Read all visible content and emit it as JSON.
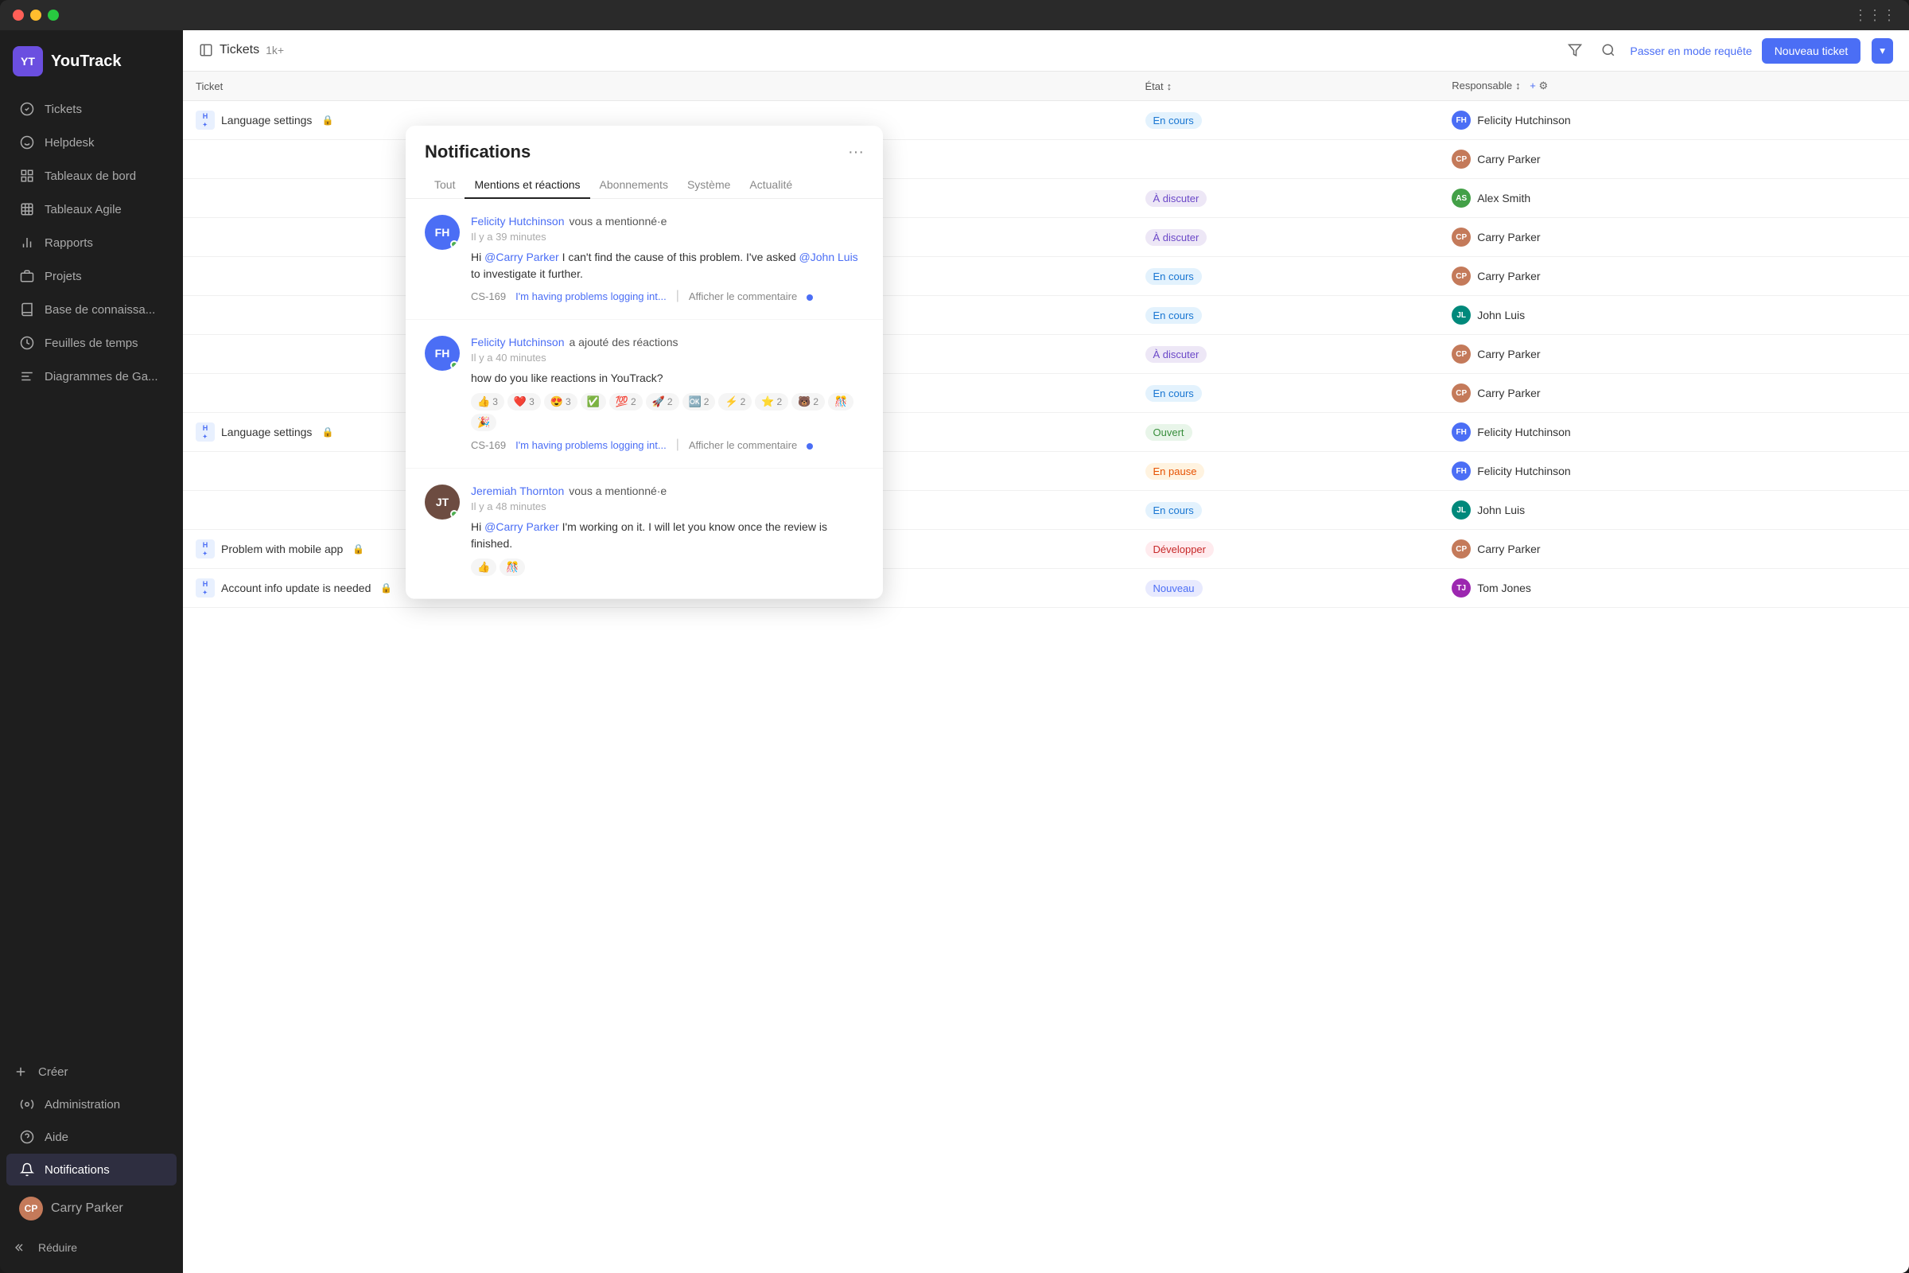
{
  "window": {
    "title": "YouTrack"
  },
  "sidebar": {
    "logo": "YT",
    "app_name": "YouTrack",
    "nav_items": [
      {
        "id": "tickets",
        "label": "Tickets",
        "icon": "check-circle"
      },
      {
        "id": "helpdesk",
        "label": "Helpdesk",
        "icon": "headset"
      },
      {
        "id": "tableaux-bord",
        "label": "Tableaux de bord",
        "icon": "layout"
      },
      {
        "id": "tableaux-agile",
        "label": "Tableaux Agile",
        "icon": "grid"
      },
      {
        "id": "rapports",
        "label": "Rapports",
        "icon": "bar-chart"
      },
      {
        "id": "projets",
        "label": "Projets",
        "icon": "briefcase"
      },
      {
        "id": "base-connaissance",
        "label": "Base de connaissa...",
        "icon": "book"
      },
      {
        "id": "feuilles-temps",
        "label": "Feuilles de temps",
        "icon": "clock"
      },
      {
        "id": "diagrammes",
        "label": "Diagrammes de Ga...",
        "icon": "gantt"
      }
    ],
    "bottom_items": [
      {
        "id": "creer",
        "label": "Créer",
        "icon": "plus"
      },
      {
        "id": "administration",
        "label": "Administration",
        "icon": "settings"
      },
      {
        "id": "aide",
        "label": "Aide",
        "icon": "help-circle"
      },
      {
        "id": "notifications",
        "label": "Notifications",
        "icon": "bell",
        "active": true
      }
    ],
    "user": {
      "name": "Carry Parker",
      "initials": "CP"
    },
    "collapse_label": "Réduire"
  },
  "main": {
    "header": {
      "title": "Tickets",
      "count": "1k+",
      "new_ticket_label": "Nouveau ticket",
      "query_mode_label": "Passer en mode requête"
    },
    "table": {
      "columns": {
        "state": "État",
        "responsible": "Responsable"
      },
      "rows": [
        {
          "ticket": "Language settings",
          "has_lock": true,
          "status": "En cours",
          "status_class": "status-en-cours",
          "responsible": "Felicity Hutchinson",
          "avatar_class": "avatar-blue",
          "avatar_initials": "FH"
        },
        {
          "ticket": "",
          "has_lock": false,
          "status": "",
          "status_class": "",
          "responsible": "Carry Parker",
          "avatar_class": "avatar-orange",
          "avatar_initials": "CP"
        },
        {
          "ticket": "",
          "has_lock": false,
          "status": "À discuter",
          "status_class": "status-discuter",
          "responsible": "Alex Smith",
          "avatar_class": "avatar-green",
          "avatar_initials": "AS"
        },
        {
          "ticket": "",
          "has_lock": false,
          "status": "À discuter",
          "status_class": "status-discuter",
          "responsible": "Carry Parker",
          "avatar_class": "avatar-orange",
          "avatar_initials": "CP"
        },
        {
          "ticket": "",
          "has_lock": false,
          "status": "En cours",
          "status_class": "status-en-cours",
          "responsible": "Carry Parker",
          "avatar_class": "avatar-orange",
          "avatar_initials": "CP"
        },
        {
          "ticket": "",
          "has_lock": false,
          "status": "En cours",
          "status_class": "status-en-cours",
          "responsible": "John Luis",
          "avatar_class": "avatar-teal",
          "avatar_initials": "JL"
        },
        {
          "ticket": "",
          "has_lock": false,
          "status": "À discuter",
          "status_class": "status-discuter",
          "responsible": "Carry Parker",
          "avatar_class": "avatar-orange",
          "avatar_initials": "CP"
        },
        {
          "ticket": "",
          "has_lock": false,
          "status": "En cours",
          "status_class": "status-en-cours",
          "responsible": "Carry Parker",
          "avatar_class": "avatar-orange",
          "avatar_initials": "CP"
        },
        {
          "ticket": "Language settings",
          "has_lock": true,
          "status": "Ouvert",
          "status_class": "status-ouvert",
          "responsible": "Felicity Hutchinson",
          "avatar_class": "avatar-blue",
          "avatar_initials": "FH"
        },
        {
          "ticket": "",
          "has_lock": false,
          "status": "En pause",
          "status_class": "status-pause",
          "responsible": "Felicity Hutchinson",
          "avatar_class": "avatar-blue",
          "avatar_initials": "FH"
        },
        {
          "ticket": "",
          "has_lock": false,
          "status": "En cours",
          "status_class": "status-en-cours",
          "responsible": "John Luis",
          "avatar_class": "avatar-teal",
          "avatar_initials": "JL"
        },
        {
          "ticket": "Problem with mobile app",
          "has_lock": true,
          "status": "Développer",
          "status_class": "status-developper",
          "responsible": "Carry Parker",
          "avatar_class": "avatar-orange",
          "avatar_initials": "CP"
        },
        {
          "ticket": "Account info update is needed",
          "has_lock": true,
          "status": "Nouveau",
          "status_class": "status-nouveau",
          "responsible": "Tom Jones",
          "avatar_class": "avatar-purple",
          "avatar_initials": "TJ"
        }
      ]
    }
  },
  "notifications": {
    "title": "Notifications",
    "tabs": [
      "Tout",
      "Mentions et réactions",
      "Abonnements",
      "Système",
      "Actualité"
    ],
    "active_tab": "Mentions et réactions",
    "items": [
      {
        "id": 1,
        "author": "Felicity Hutchinson",
        "author_initials": "FH",
        "avatar_color": "#4b6ef5",
        "online": true,
        "action": "vous a mentionné·e",
        "time": "Il y a 39 minutes",
        "text_parts": [
          {
            "type": "text",
            "value": "Hi "
          },
          {
            "type": "mention",
            "value": "@Carry Parker"
          },
          {
            "type": "text",
            "value": " I can't find the cause of this problem. I've asked "
          },
          {
            "type": "mention",
            "value": "@John Luis"
          },
          {
            "type": "text",
            "value": " to investigate it further."
          }
        ],
        "ticket_ref": "CS-169",
        "ticket_link": "I'm having problems logging int...",
        "view_label": "Afficher le commentaire",
        "has_unread": true,
        "reactions": []
      },
      {
        "id": 2,
        "author": "Felicity Hutchinson",
        "author_initials": "FH",
        "avatar_color": "#4b6ef5",
        "online": true,
        "action": "a ajouté des réactions",
        "time": "Il y a 40 minutes",
        "text_parts": [
          {
            "type": "text",
            "value": "how do you like reactions in YouTrack?"
          }
        ],
        "reactions": [
          {
            "emoji": "👍",
            "count": 3
          },
          {
            "emoji": "❤️",
            "count": 3
          },
          {
            "emoji": "😍",
            "count": 3
          },
          {
            "emoji": "✅",
            "count": ""
          },
          {
            "emoji": "💯",
            "count": 2
          },
          {
            "emoji": "🚀",
            "count": 2
          },
          {
            "emoji": "🆗",
            "count": 2
          },
          {
            "emoji": "⚡",
            "count": 2
          },
          {
            "emoji": "⭐",
            "count": 2
          },
          {
            "emoji": "🐻",
            "count": 2
          },
          {
            "emoji": "🎊",
            "count": ""
          },
          {
            "emoji": "🎉",
            "count": ""
          }
        ],
        "ticket_ref": "CS-169",
        "ticket_link": "I'm having problems logging int...",
        "view_label": "Afficher le commentaire",
        "has_unread": true
      },
      {
        "id": 3,
        "author": "Jeremiah Thornton",
        "author_initials": "JT",
        "avatar_color": "#6d4c41",
        "online": true,
        "action": "vous a mentionné·e",
        "time": "Il y a 48 minutes",
        "text_parts": [
          {
            "type": "text",
            "value": "Hi "
          },
          {
            "type": "mention",
            "value": "@Carry Parker"
          },
          {
            "type": "text",
            "value": " I'm working on it. I will let you know once the review is finished."
          }
        ],
        "reactions": [
          {
            "emoji": "👍",
            "count": ""
          },
          {
            "emoji": "🎊",
            "count": ""
          }
        ],
        "ticket_ref": "",
        "ticket_link": "",
        "view_label": "",
        "has_unread": false
      }
    ]
  }
}
